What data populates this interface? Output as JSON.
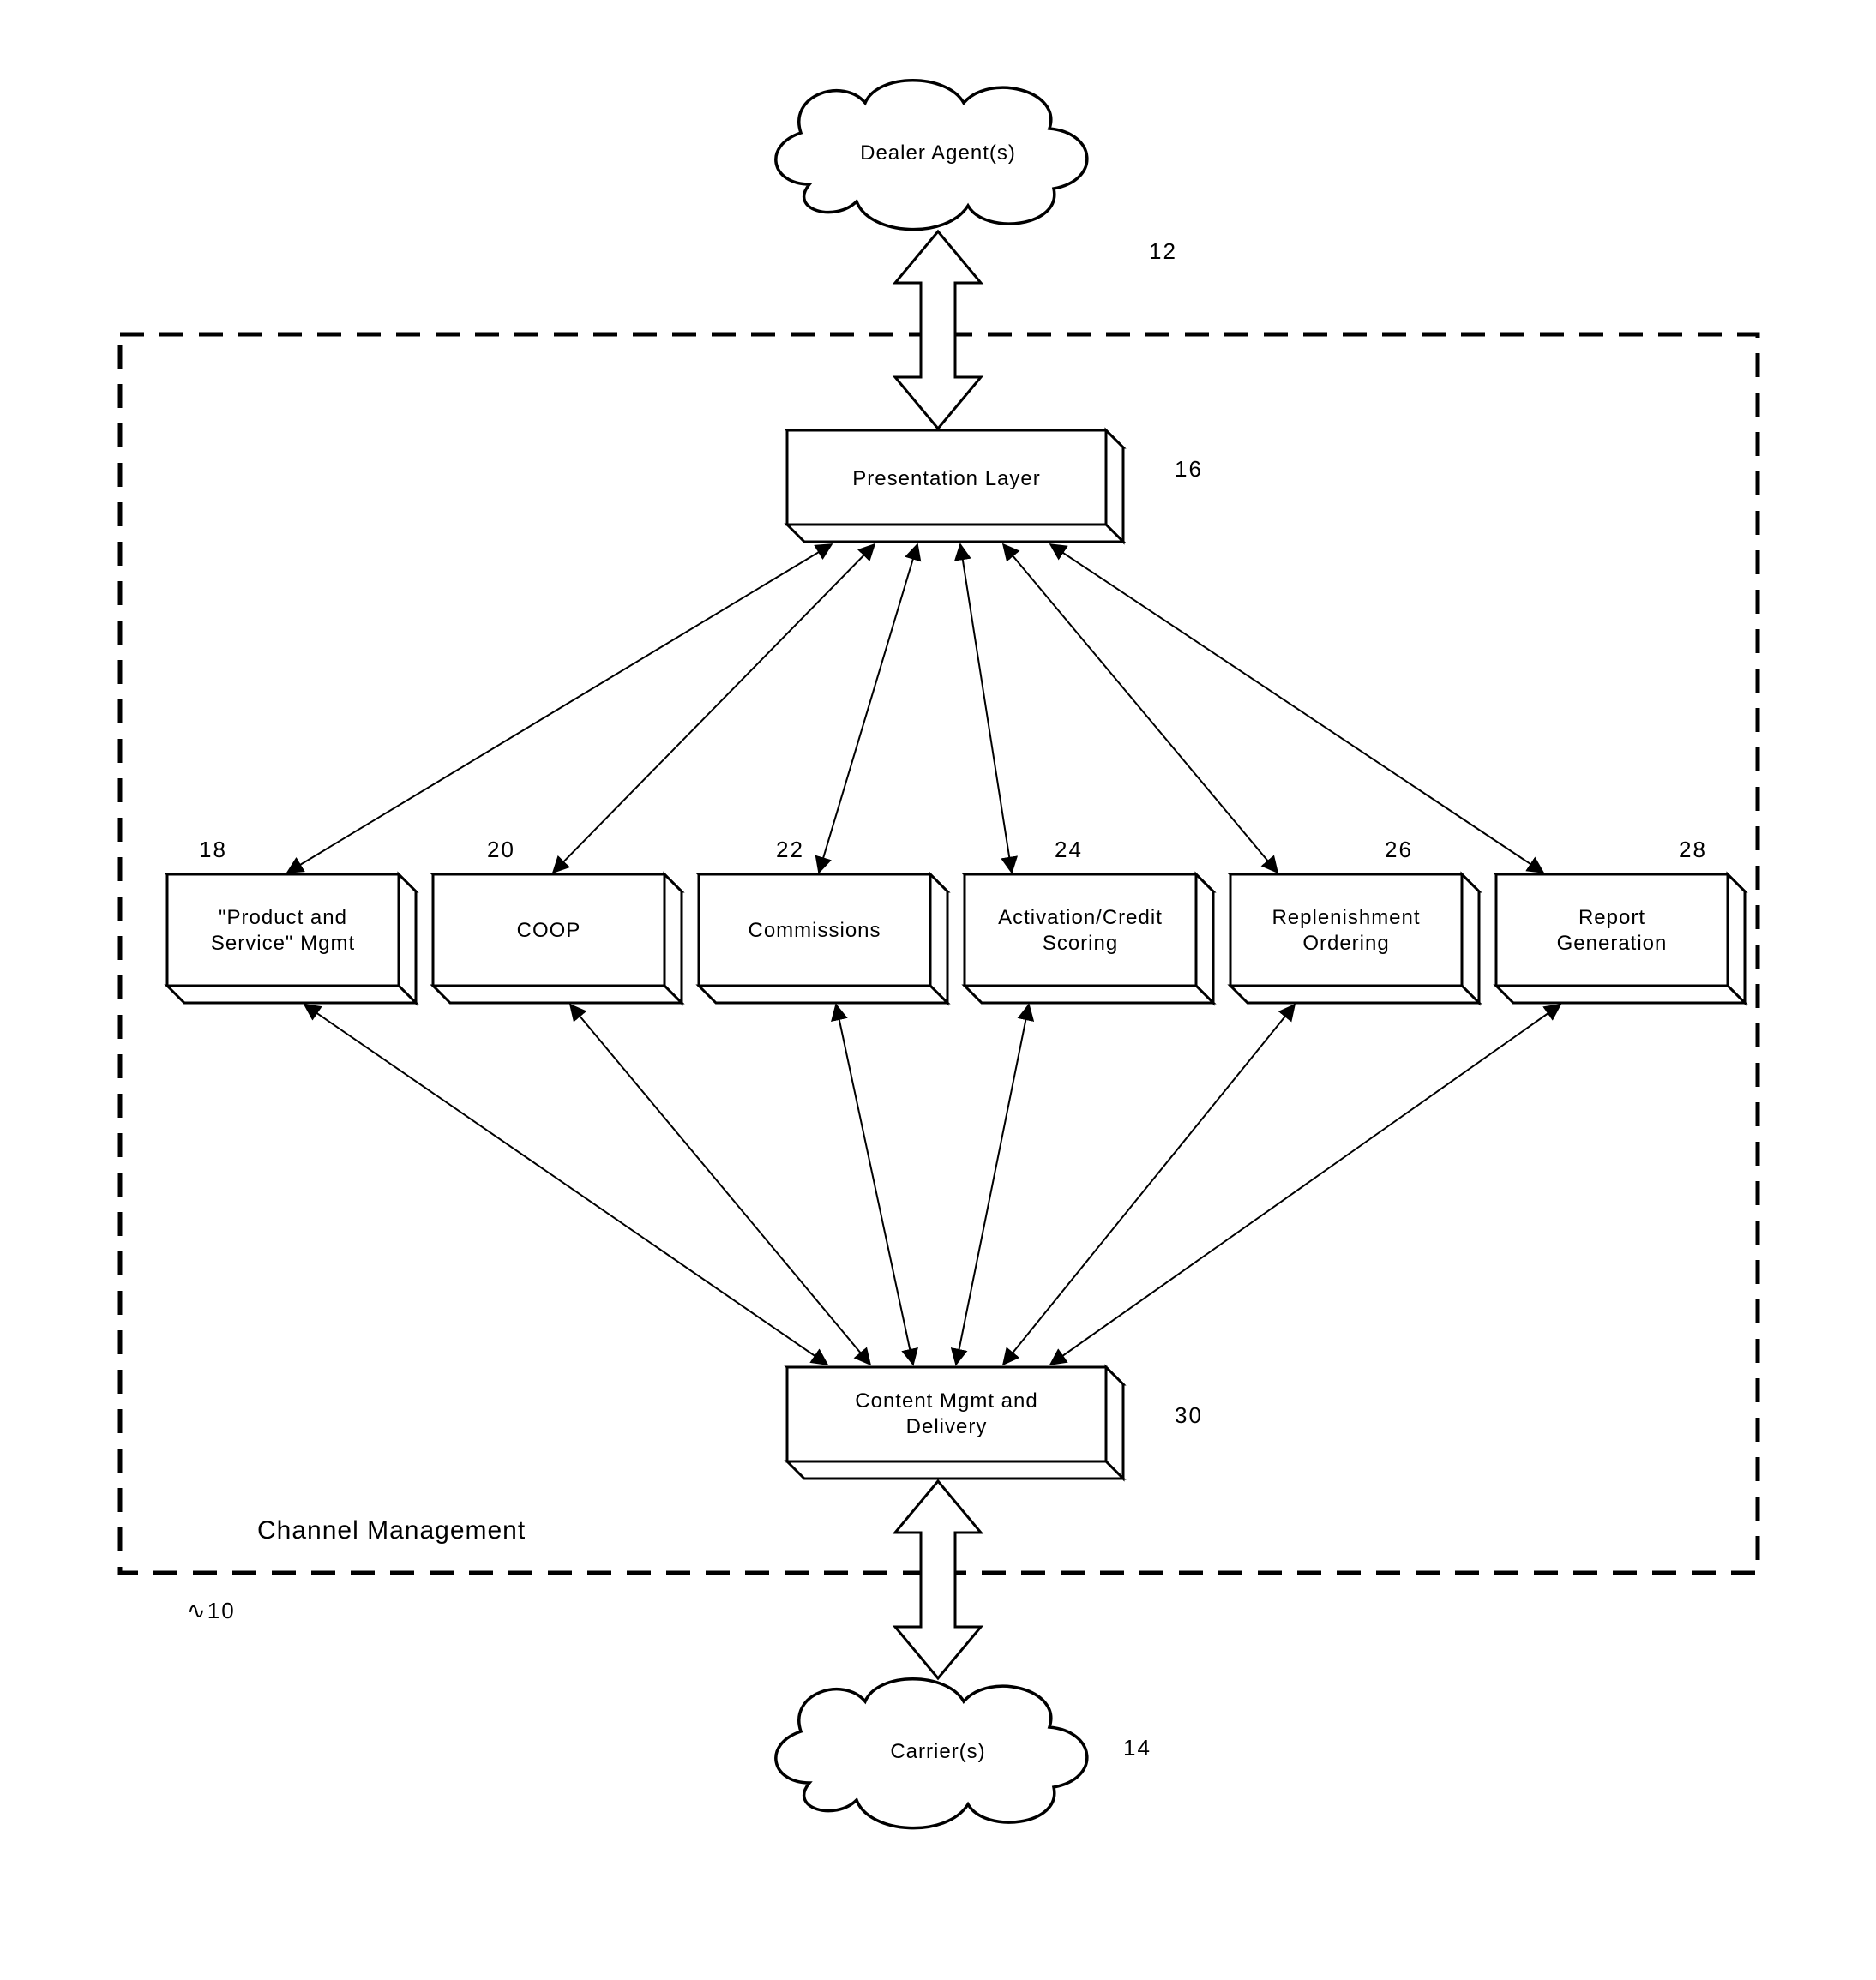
{
  "clouds": {
    "dealer": {
      "label": "Dealer Agent(s)",
      "ref": "12"
    },
    "carrier": {
      "label": "Carrier(s)",
      "ref": "14"
    }
  },
  "region": {
    "label": "Channel Management",
    "ref": "10"
  },
  "boxes": {
    "presentation": {
      "label": "Presentation Layer",
      "ref": "16"
    },
    "content": {
      "line1": "Content Mgmt and",
      "line2": "Delivery",
      "ref": "30"
    },
    "b18": {
      "line1": "\"Product and",
      "line2": "Service\" Mgmt",
      "ref": "18"
    },
    "b20": {
      "line1": "COOP",
      "ref": "20"
    },
    "b22": {
      "line1": "Commissions",
      "ref": "22"
    },
    "b24": {
      "line1": "Activation/Credit",
      "line2": "Scoring",
      "ref": "24"
    },
    "b26": {
      "line1": "Replenishment",
      "line2": "Ordering",
      "ref": "26"
    },
    "b28": {
      "line1": "Report",
      "line2": "Generation",
      "ref": "28"
    }
  }
}
